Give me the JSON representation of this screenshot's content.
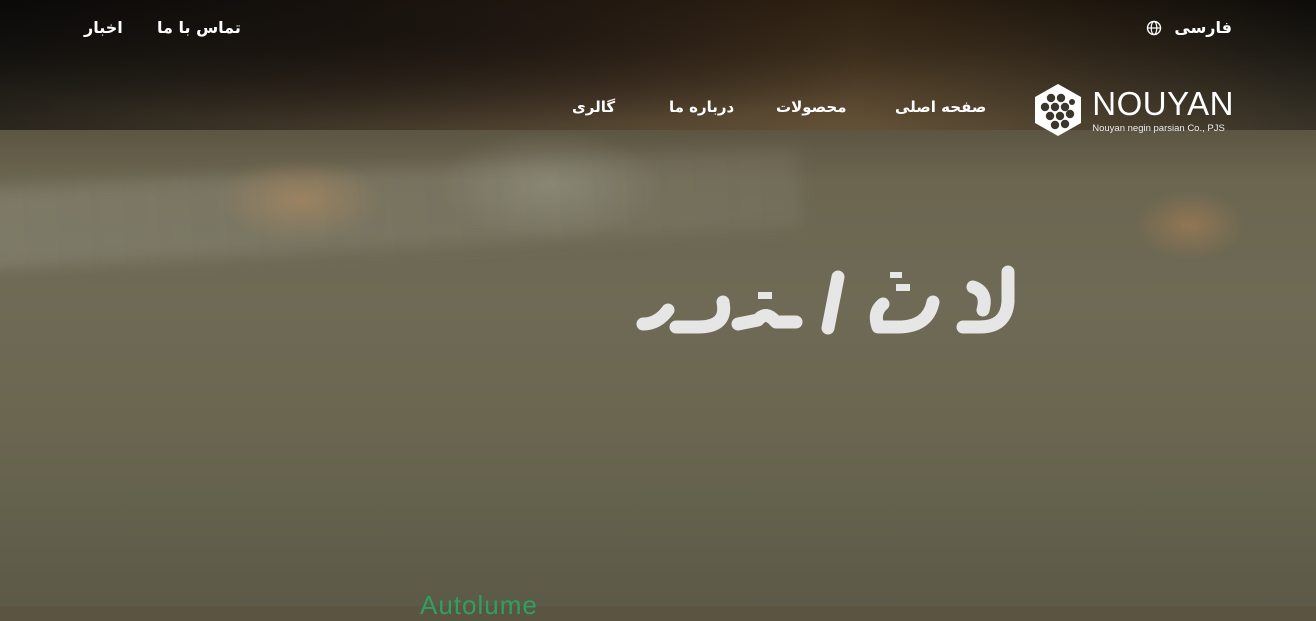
{
  "topbar": {
    "language": "فارسی",
    "contact": "تماس با ما",
    "news": "اخبار"
  },
  "nav": {
    "items": [
      {
        "label": "صفحه اصلی"
      },
      {
        "label": "محصولات"
      },
      {
        "label": "درباره ما"
      },
      {
        "label": "گالری"
      }
    ]
  },
  "logo": {
    "name": "NOUYAN",
    "subtitle": "Nouyan negin parsian Co., PJS"
  },
  "hero": {
    "slogan": "لذت اعتماد",
    "bottom_text": "Autolume"
  }
}
